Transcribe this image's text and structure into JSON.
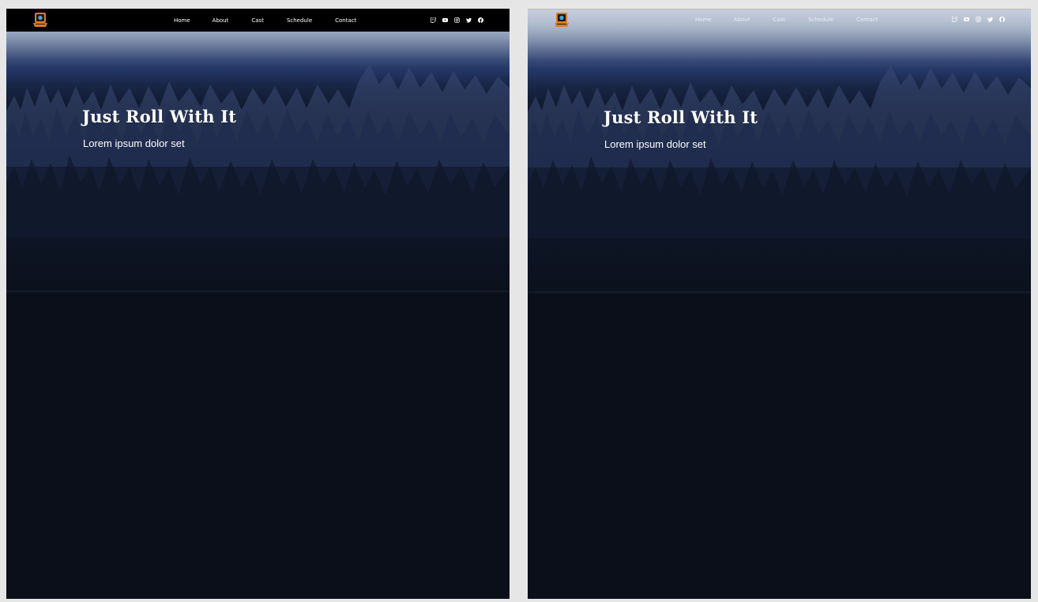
{
  "boards": [
    {
      "nav": {
        "links": [
          "Home",
          "About",
          "Cast",
          "Schedule",
          "Contact"
        ],
        "socials": [
          "twitch-icon",
          "youtube-icon",
          "instagram-icon",
          "twitter-icon",
          "facebook-icon"
        ]
      },
      "hero": {
        "title": "Just Roll With It",
        "subtitle": "Lorem ipsum dolor set"
      }
    },
    {
      "nav": {
        "links": [
          "Home",
          "About",
          "Cast",
          "Schedule",
          "Contact"
        ],
        "socials": [
          "twitch-icon",
          "youtube-icon",
          "instagram-icon",
          "twitter-icon",
          "facebook-icon"
        ]
      },
      "hero": {
        "title": "Just Roll With It",
        "subtitle": "Lorem ipsum dolor set"
      }
    }
  ],
  "colors": {
    "page_background": "#e6e6e6",
    "navbar_solid": "#000000",
    "site_background": "#0a0f19",
    "text": "#ffffff",
    "logo_accent": "#e07a1a"
  }
}
